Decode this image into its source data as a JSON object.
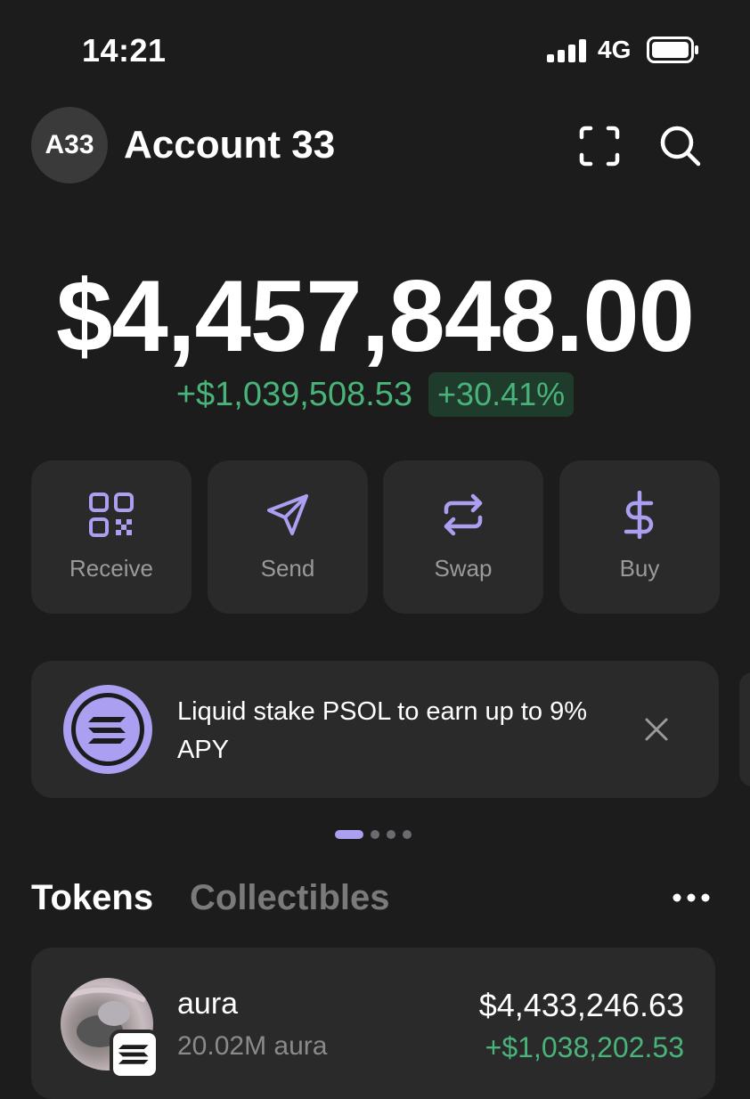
{
  "status_bar": {
    "time": "14:21",
    "network": "4G"
  },
  "header": {
    "avatar_initials": "A33",
    "account_name": "Account 33",
    "icons": [
      "scan-icon",
      "search-icon"
    ]
  },
  "balance": {
    "total": "$4,457,848.00",
    "change_amount": "+$1,039,508.53",
    "change_percent": "+30.41%"
  },
  "actions": [
    {
      "label": "Receive",
      "icon": "qr-code-icon"
    },
    {
      "label": "Send",
      "icon": "send-icon"
    },
    {
      "label": "Swap",
      "icon": "swap-icon"
    },
    {
      "label": "Buy",
      "icon": "dollar-icon"
    }
  ],
  "promo": {
    "text": "Liquid stake PSOL to earn up to 9% APY",
    "icon": "solana-icon"
  },
  "pagination": {
    "total": 4,
    "active": 1
  },
  "tabs": {
    "tokens": "Tokens",
    "collectibles": "Collectibles",
    "active": "Tokens"
  },
  "tokens": [
    {
      "name": "aura",
      "amount": "20.02M aura",
      "value": "$4,433,246.63",
      "change": "+$1,038,202.53"
    }
  ],
  "colors": {
    "background": "#1c1c1c",
    "card": "#2a2a2a",
    "accent": "#ab9ff2",
    "positive": "#49b47a"
  }
}
